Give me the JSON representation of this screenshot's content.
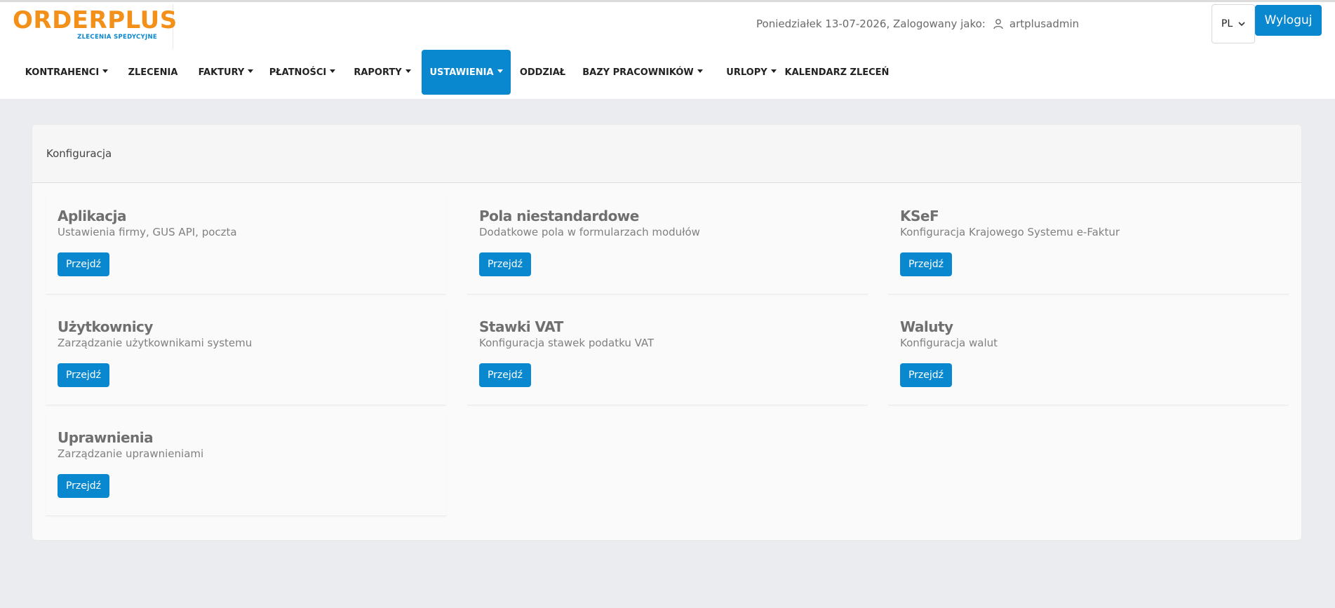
{
  "logo": {
    "main": "ORDERPLUS",
    "sub": "ZLECENIA SPEDYCYJNE"
  },
  "status": {
    "text": "Poniedziałek 13-07-2026, Zalogowany jako:",
    "username": "artplusadmin"
  },
  "language": {
    "selected": "PL"
  },
  "logout_label": "Wyloguj",
  "nav": {
    "items": [
      {
        "label": "KONTRAHENCI",
        "dropdown": true
      },
      {
        "label": "ZLECENIA",
        "dropdown": false
      },
      {
        "label": "FAKTURY",
        "dropdown": true
      },
      {
        "label": "PŁATNOŚCI",
        "dropdown": true
      },
      {
        "label": "RAPORTY",
        "dropdown": true
      },
      {
        "label": "USTAWIENIA",
        "dropdown": true,
        "active": true
      },
      {
        "label": "ODDZIAŁ",
        "dropdown": false
      },
      {
        "label": "BAZY PRACOWNIKÓW",
        "dropdown": true
      },
      {
        "label": "URLOPY",
        "dropdown": true
      },
      {
        "label": "KALENDARZ ZLECEŃ",
        "dropdown": false
      }
    ]
  },
  "panel": {
    "title": "Konfiguracja",
    "cards": [
      {
        "title": "Aplikacja",
        "description": "Ustawienia firmy, GUS API, poczta",
        "button": "Przejdź"
      },
      {
        "title": "Pola niestandardowe",
        "description": "Dodatkowe pola w formularzach modułów",
        "button": "Przejdź"
      },
      {
        "title": "KSeF",
        "description": "Konfiguracja Krajowego Systemu e-Faktur",
        "button": "Przejdź"
      },
      {
        "title": "Użytkownicy",
        "description": "Zarządzanie użytkownikami systemu",
        "button": "Przejdź"
      },
      {
        "title": "Stawki VAT",
        "description": "Konfiguracja stawek podatku VAT",
        "button": "Przejdź"
      },
      {
        "title": "Waluty",
        "description": "Konfiguracja walut",
        "button": "Przejdź"
      },
      {
        "title": "Uprawnienia",
        "description": "Zarządzanie uprawnieniami",
        "button": "Przejdź"
      }
    ]
  },
  "colors": {
    "brand_orange": "#f39019",
    "accent_blue": "#0a88cf",
    "background": "#ebecef"
  }
}
